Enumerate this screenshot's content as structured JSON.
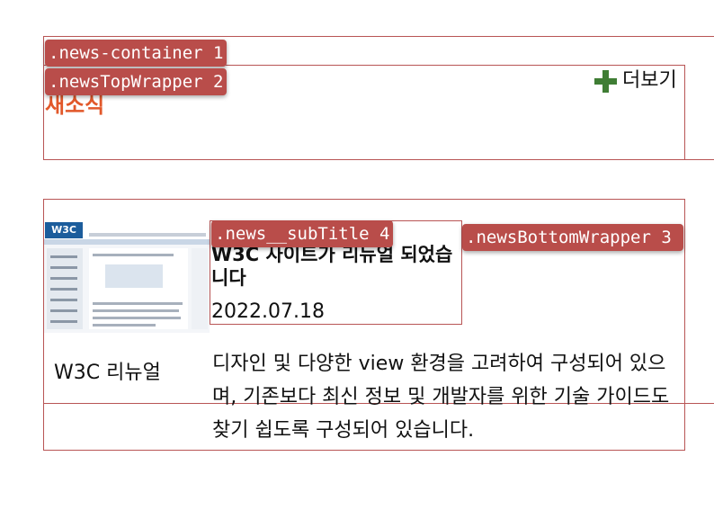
{
  "labels": {
    "container": ".news-container 1",
    "top_wrapper": ".newsTopWrapper 2",
    "sub_title": ".news__subTitle 4",
    "bottom_wrapper": ".newsBottomWrapper 3"
  },
  "news": {
    "title": "새소식",
    "more_label": "더보기",
    "more_icon": "plus-icon",
    "accent_color": "#e2582a",
    "icon_color": "#3f7d34"
  },
  "article": {
    "thumbnail_logo": "W3C",
    "thumbnail_caption": "W3C 리뉴얼",
    "sub_title": "W3C 사이트가 리뉴얼 되었습니다",
    "date": "2022.07.18",
    "description": "디자인 및 다양한 view 환경을 고려하여 구성되어 있으며, 기존보다 최신 정보 및 개발자를 위한 기술 가이드도 찾기 쉽도록 구성되어 있습니다."
  }
}
